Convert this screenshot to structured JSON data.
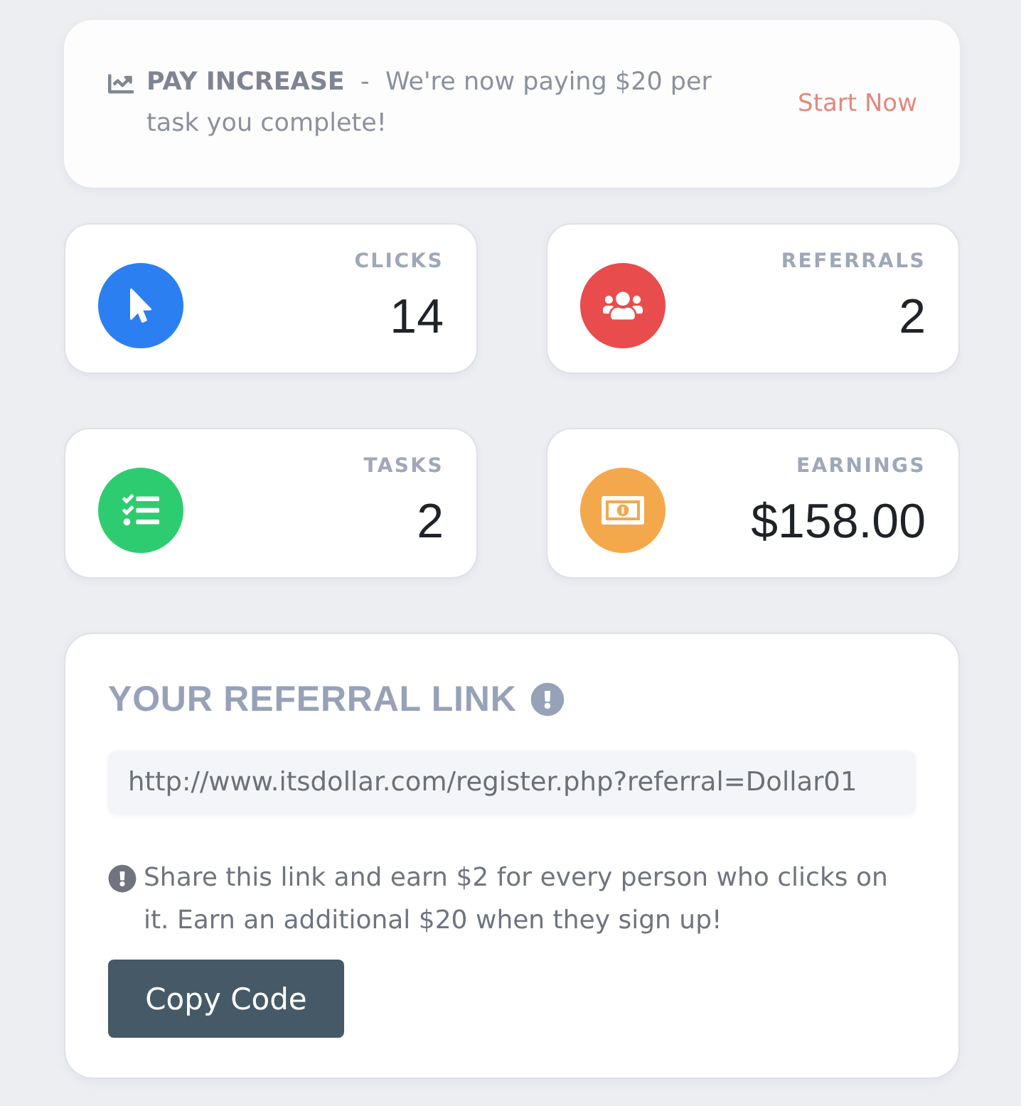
{
  "banner": {
    "text": "**PAY INCREASE**  -  We're now paying $20 per task you complete!",
    "action": "Start Now"
  },
  "stats": [
    {
      "label": "CLICKS",
      "value": "14",
      "color": "#2b7ff0"
    },
    {
      "label": "REFERRALS",
      "value": "2",
      "color": "#e84c4c"
    },
    {
      "label": "TASKS",
      "value": "2",
      "color": "#2ecc71"
    },
    {
      "label": "EARNINGS",
      "value": "$158.00",
      "color": "#f4a84c"
    }
  ],
  "referral": {
    "title": "YOUR REFERRAL LINK",
    "link": "http://www.itsdollar.com/register.php?referral=Dollar01",
    "note": "Share this link and earn $2 for every person who clicks on it. Earn an additional $20 when they sign up!",
    "button": "Copy Code"
  }
}
